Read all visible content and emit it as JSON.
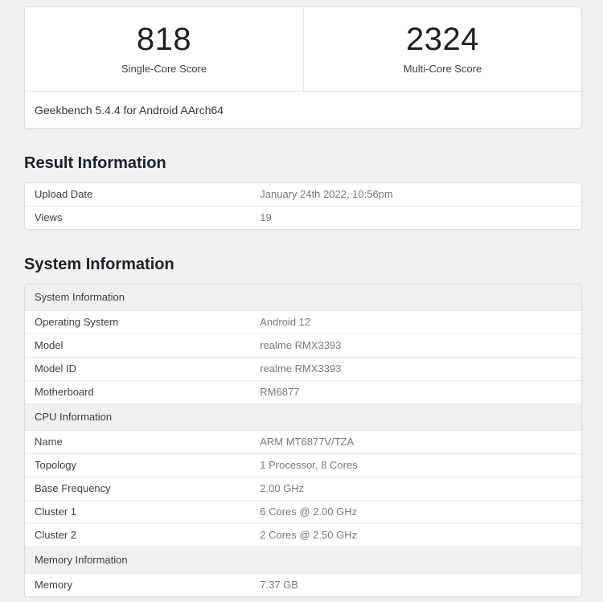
{
  "scores": {
    "single_core": {
      "value": "818",
      "label": "Single-Core Score"
    },
    "multi_core": {
      "value": "2324",
      "label": "Multi-Core Score"
    },
    "platform": "Geekbench 5.4.4 for Android AArch64"
  },
  "result_information": {
    "heading": "Result Information",
    "rows": [
      {
        "label": "Upload Date",
        "value": "January 24th 2022, 10:56pm"
      },
      {
        "label": "Views",
        "value": "19"
      }
    ]
  },
  "system_information": {
    "heading": "System Information",
    "groups": [
      {
        "header": "System Information",
        "rows": [
          {
            "label": "Operating System",
            "value": "Android 12"
          },
          {
            "label": "Model",
            "value": "realme RMX3393"
          },
          {
            "label": "Model ID",
            "value": "realme RMX3393"
          },
          {
            "label": "Motherboard",
            "value": "RM6877"
          }
        ]
      },
      {
        "header": "CPU Information",
        "rows": [
          {
            "label": "Name",
            "value": "ARM MT6877V/TZA"
          },
          {
            "label": "Topology",
            "value": "1 Processor, 8 Cores"
          },
          {
            "label": "Base Frequency",
            "value": "2.00 GHz"
          },
          {
            "label": "Cluster 1",
            "value": "6 Cores @ 2.00 GHz"
          },
          {
            "label": "Cluster 2",
            "value": "2 Cores @ 2.50 GHz"
          }
        ]
      },
      {
        "header": "Memory Information",
        "rows": [
          {
            "label": "Memory",
            "value": "7.37 GB"
          }
        ]
      }
    ]
  },
  "colors": {
    "page_background": "#f1f1f2",
    "panel_background": "#ffffff",
    "border": "#dbdee1",
    "group_header_background": "#f0f0f1",
    "label_text": "#3b4045",
    "value_text": "#75797d",
    "heading_text": "#1d2125"
  }
}
